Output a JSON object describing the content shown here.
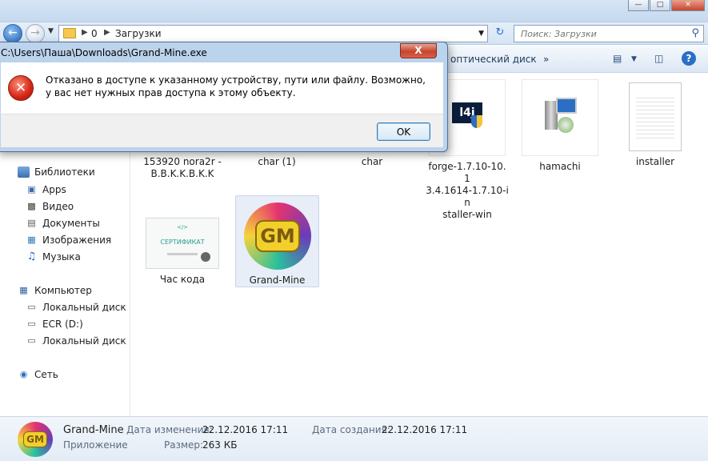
{
  "window": {
    "behind_tabs": [
      "...",
      "..."
    ],
    "controls": [
      "minimize",
      "maximize",
      "close"
    ]
  },
  "navbar": {
    "breadcrumbs": [
      "0",
      "Загрузки"
    ],
    "search_placeholder": "Поиск: Загрузки"
  },
  "toolbar": {
    "visible_item": "оптический диск",
    "more": "»"
  },
  "sidebar": {
    "libraries": {
      "label": "Библиотеки",
      "items": [
        "Apps",
        "Видео",
        "Документы",
        "Изображения",
        "Музыка"
      ]
    },
    "computer": {
      "label": "Компьютер",
      "items": [
        "Локальный диск (C",
        "ECR (D:)",
        "Локальный диск (E:"
      ]
    },
    "network": {
      "label": "Сеть"
    }
  },
  "files": [
    {
      "name": "153920 nora2r - B.B.K.K.B.K.K"
    },
    {
      "name": "char (1)"
    },
    {
      "name": "char"
    },
    {
      "name": "forge-1.7.10-10.13.4.1614-1.7.10-installer-win",
      "lines": [
        "forge-1.7.10-10.1",
        "3.4.1614-1.7.10-in",
        "staller-win"
      ]
    },
    {
      "name": "hamachi"
    },
    {
      "name": "installer"
    },
    {
      "name": "Час кода",
      "thumb_text": "СЕРТИФИКАТ"
    },
    {
      "name": "Grand-Mine",
      "thumb_text": "GM",
      "selected": true
    }
  ],
  "details": {
    "name": "Grand-Mine",
    "type": "Приложение",
    "modified_label": "Дата изменения:",
    "modified_value": "22.12.2016 17:11",
    "created_label": "Дата создания:",
    "created_value": "22.12.2016 17:11",
    "size_label": "Размер:",
    "size_value": "263 КБ"
  },
  "dialog": {
    "title": "C:\\Users\\Паша\\Downloads\\Grand-Mine.exe",
    "message": "Отказано в доступе к указанному устройству, пути или файлу. Возможно,  у вас нет нужных прав доступа к этому объекту.",
    "ok_label": "OK",
    "close_label": "X"
  },
  "colors": {
    "accent": "#2a6fc4",
    "error_red": "#d42414",
    "selection": "#e7eef7"
  }
}
